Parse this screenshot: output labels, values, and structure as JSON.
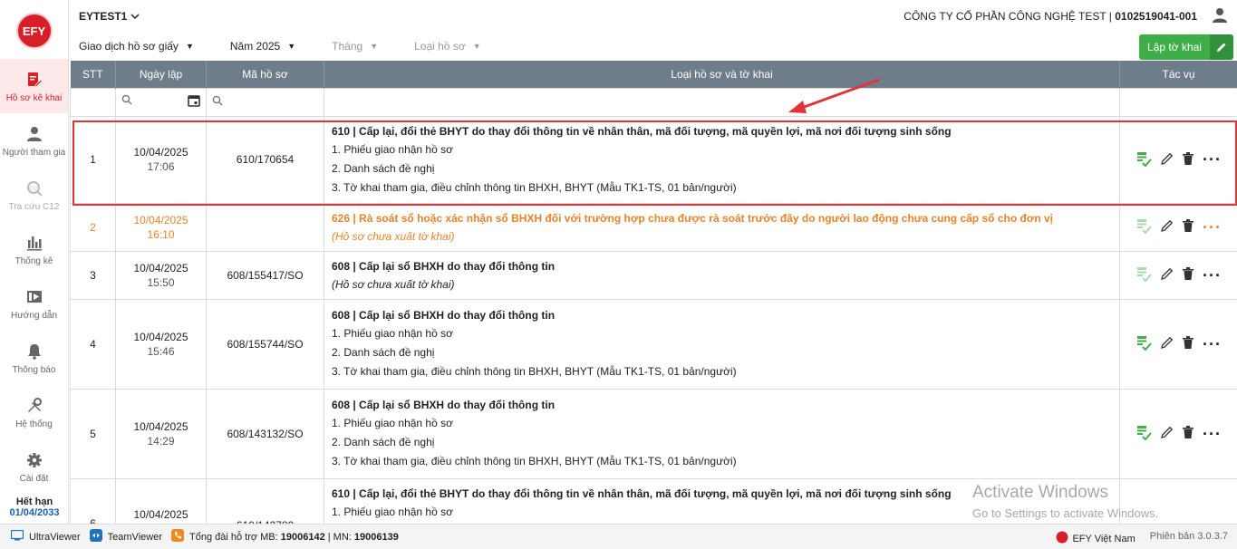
{
  "sidebar": {
    "logo": "EFY",
    "items": [
      {
        "label": "Hồ sơ kê khai",
        "icon": "document-edit-icon"
      },
      {
        "label": "Người tham gia",
        "icon": "person-icon"
      },
      {
        "label": "Tra cứu C12",
        "icon": "search-c12-icon"
      },
      {
        "label": "Thống kê",
        "icon": "bar-chart-icon"
      },
      {
        "label": "Hướng dẫn",
        "icon": "video-guide-icon"
      },
      {
        "label": "Thông báo",
        "icon": "bell-icon"
      },
      {
        "label": "Hệ thống",
        "icon": "tools-icon"
      },
      {
        "label": "Cài đặt",
        "icon": "gear-icon"
      }
    ],
    "expire_label": "Hết hạn",
    "expire_date": "01/04/2033"
  },
  "header": {
    "account": "EYTEST1",
    "company": "CÔNG TY CỔ PHẦN CÔNG NGHỆ TEST | ",
    "tax_code": "0102519041-001"
  },
  "filters": {
    "type": "Giao dịch hồ sơ giấy",
    "year": "Năm 2025",
    "month": "Tháng",
    "record_type": "Loại hồ sơ",
    "create_button": "Lập tờ khai"
  },
  "table": {
    "headers": [
      "STT",
      "Ngày lập",
      "Mã hồ sơ",
      "Loại hồ sơ và tờ khai",
      "Tác vụ"
    ],
    "rows": [
      {
        "stt": "1",
        "date": "10/04/2025",
        "time": "17:06",
        "code": "610/170654",
        "title": "610 | Cấp lại, đổi thẻ BHYT do thay đổi thông tin về nhân thân, mã đối tượng, mã quyền lợi, mã nơi đối tượng sinh sống",
        "lines": [
          "1. Phiếu giao nhận hồ sơ",
          "2. Danh sách đề nghị",
          "3. Tờ khai tham gia, điều chỉnh thông tin BHXH, BHYT (Mẫu TK1-TS, 01 bản/người)"
        ]
      },
      {
        "stt": "2",
        "date": "10/04/2025",
        "time": "16:10",
        "code": "",
        "title": "626 | Rà soát sổ hoặc xác nhận sổ BHXH đối với trường hợp chưa được rà soát trước đây do người lao động chưa cung cấp sổ cho đơn vị",
        "note": "(Hồ sơ chưa xuất tờ khai)"
      },
      {
        "stt": "3",
        "date": "10/04/2025",
        "time": "15:50",
        "code": "608/155417/SO",
        "title": "608 | Cấp lại sổ BHXH do thay đổi thông tin",
        "note": "(Hồ sơ chưa xuất tờ khai)"
      },
      {
        "stt": "4",
        "date": "10/04/2025",
        "time": "15:46",
        "code": "608/155744/SO",
        "title": "608 | Cấp lại sổ BHXH do thay đổi thông tin",
        "lines": [
          "1. Phiếu giao nhận hồ sơ",
          "2. Danh sách đề nghị",
          "3. Tờ khai tham gia, điều chỉnh thông tin BHXH, BHYT (Mẫu TK1-TS, 01 bản/người)"
        ]
      },
      {
        "stt": "5",
        "date": "10/04/2025",
        "time": "14:29",
        "code": "608/143132/SO",
        "title": "608 | Cấp lại sổ BHXH do thay đổi thông tin",
        "lines": [
          "1. Phiếu giao nhận hồ sơ",
          "2. Danh sách đề nghị",
          "3. Tờ khai tham gia, điều chỉnh thông tin BHXH, BHYT (Mẫu TK1-TS, 01 bản/người)"
        ]
      },
      {
        "stt": "6",
        "date": "10/04/2025",
        "time": "",
        "code": "610/142780",
        "title": "610 | Cấp lại, đổi thẻ BHYT do thay đổi thông tin về nhân thân, mã đối tượng, mã quyền lợi, mã nơi đối tượng sinh sống",
        "lines": [
          "1. Phiếu giao nhận hồ sơ"
        ]
      }
    ]
  },
  "statusbar": {
    "ultraviewer": "UltraViewer",
    "teamviewer": "TeamViewer",
    "hotline_label": "Tổng đài hỗ trợ MB: ",
    "hotline_mb": "19006142",
    "hotline_sep": " | MN: ",
    "hotline_mn": "19006139",
    "brand": "EFY Việt Nam",
    "version": "Phiên bản 3.0.3.7"
  },
  "watermark": {
    "line1": "Activate Windows",
    "line2": "Go to Settings to activate Windows."
  },
  "colors": {
    "brand_red": "#d81e26",
    "header_gray": "#6f7c8a",
    "accent_green": "#3fae49",
    "pending_orange": "#e8832a"
  }
}
